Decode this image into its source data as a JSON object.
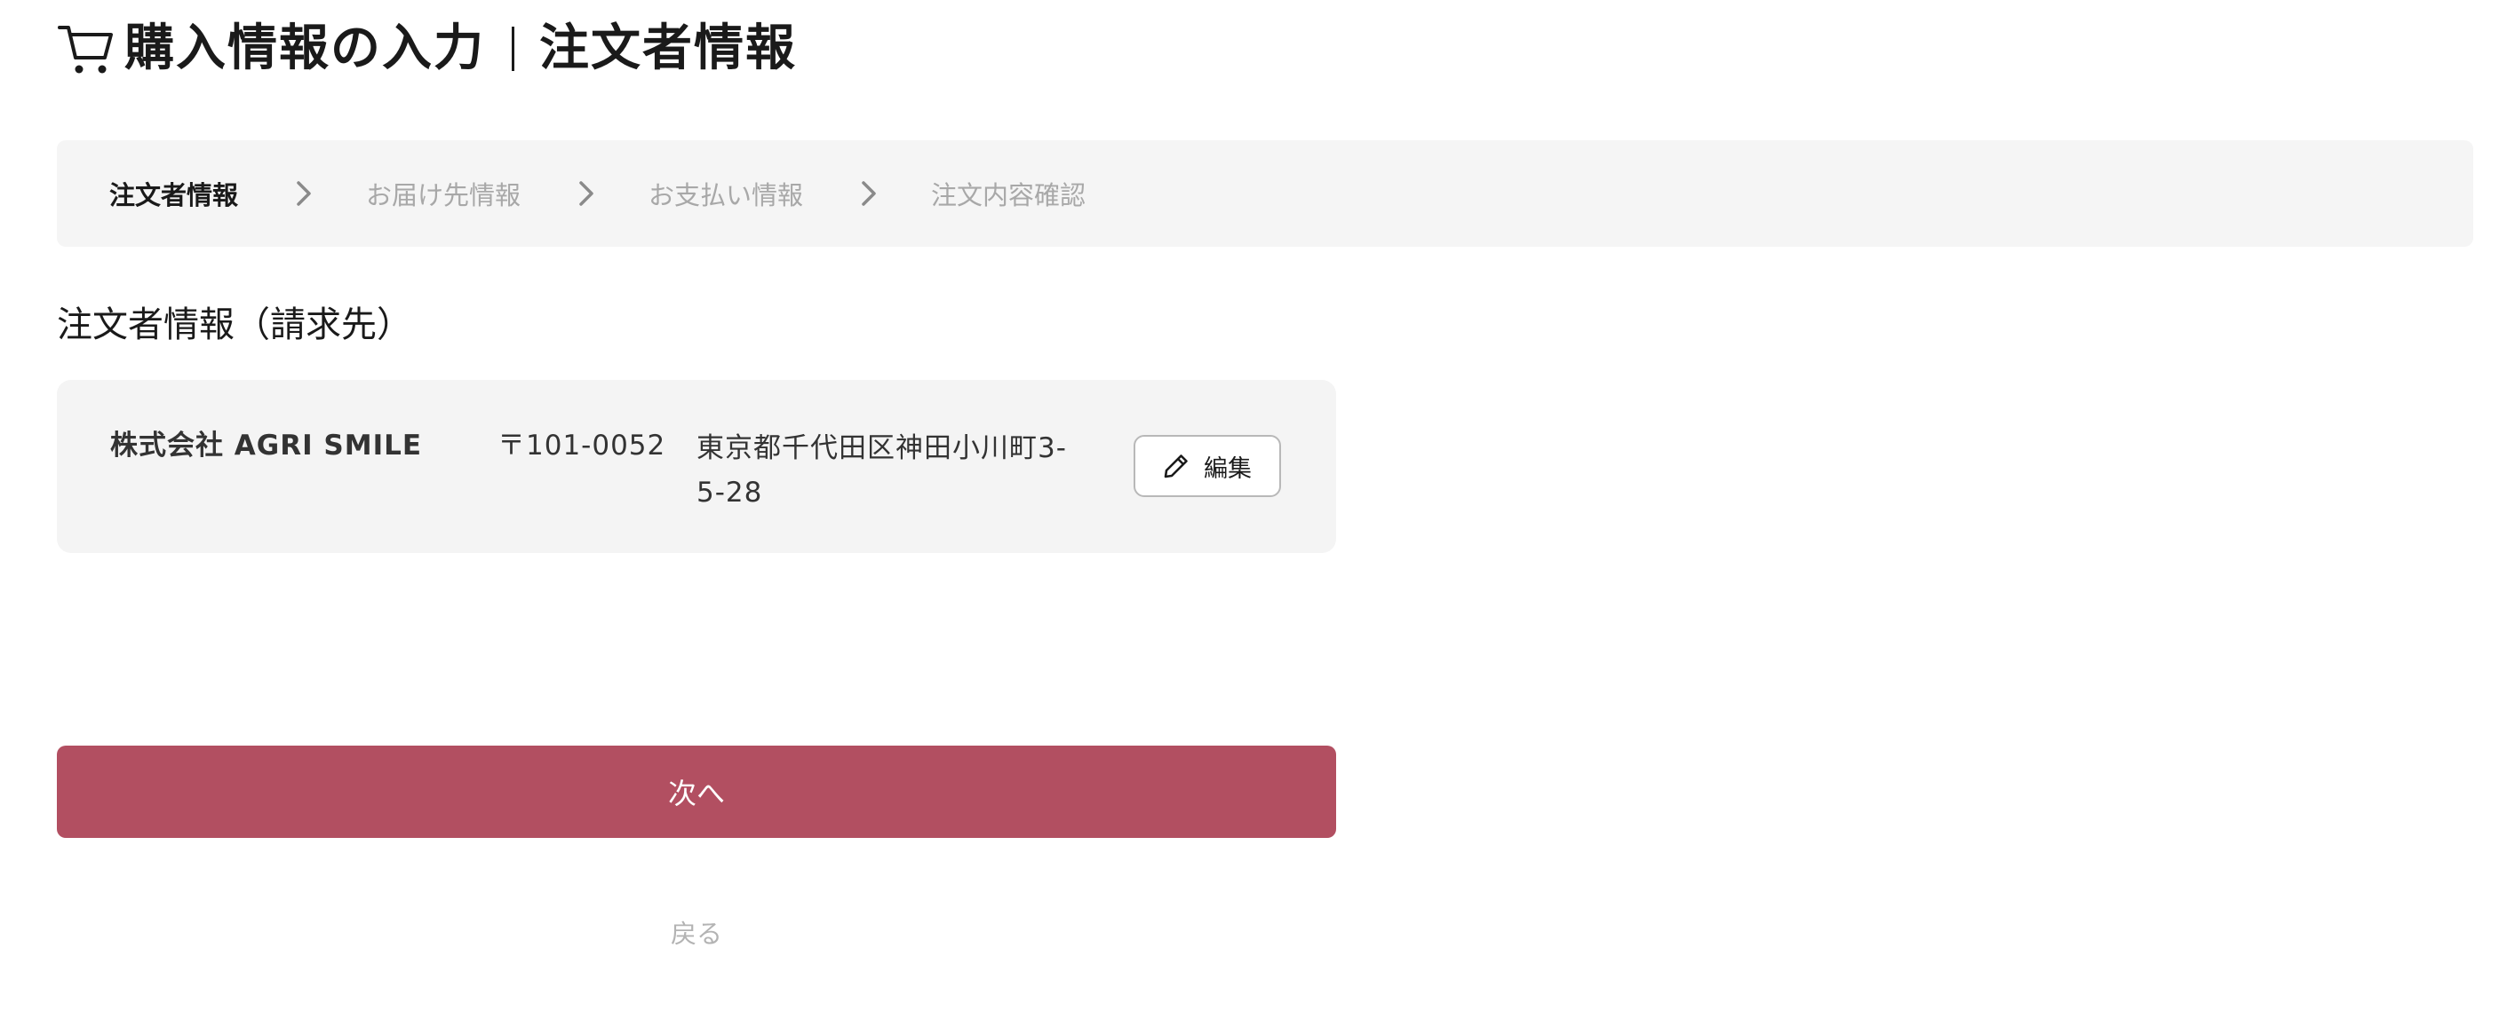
{
  "header": {
    "icon": "cart-icon",
    "title_main": "購入情報の入力",
    "title_sub": "注文者情報"
  },
  "stepper": {
    "steps": [
      {
        "label": "注文者情報",
        "active": true
      },
      {
        "label": "お届け先情報",
        "active": false
      },
      {
        "label": "お支払い情報",
        "active": false
      },
      {
        "label": "注文内容確認",
        "active": false
      }
    ],
    "separator_icon": "chevron-right-icon"
  },
  "orderer": {
    "section_title": "注文者情報（請求先）",
    "company": "株式会社 AGRI SMILE",
    "postal": "〒101-0052",
    "address": "東京都千代田区神田小川町3-5-28",
    "edit_label": "編集",
    "edit_icon": "pencil-icon"
  },
  "actions": {
    "next_label": "次へ",
    "back_label": "戻る"
  },
  "colors": {
    "accent": "#b24f61",
    "panel_bg": "#f5f5f5",
    "inactive_text": "#a8a8a8"
  }
}
